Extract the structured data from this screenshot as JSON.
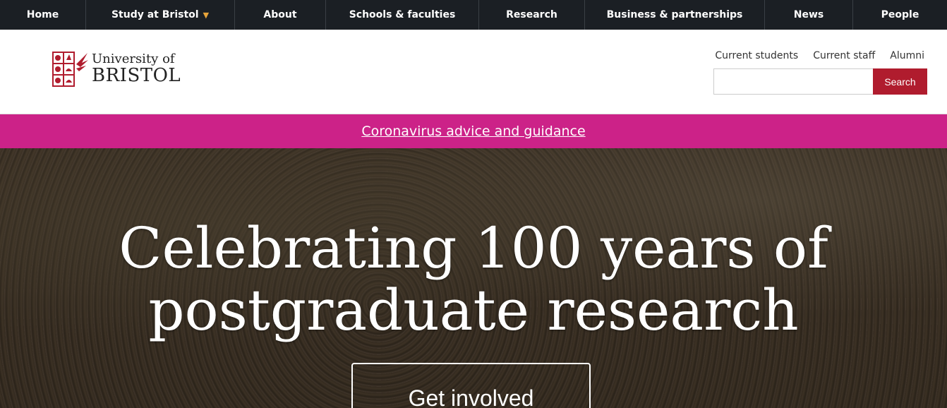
{
  "nav": {
    "items": [
      {
        "label": "Home"
      },
      {
        "label": "Study at Bristol",
        "dropdown": true
      },
      {
        "label": "About"
      },
      {
        "label": "Schools & faculties"
      },
      {
        "label": "Research"
      },
      {
        "label": "Business & partnerships"
      },
      {
        "label": "News"
      },
      {
        "label": "People"
      }
    ]
  },
  "header": {
    "logo_line1": "University of",
    "logo_line2": "BRISTOL",
    "links": [
      "Current students",
      "Current staff",
      "Alumni"
    ],
    "search_value": "",
    "search_button": "Search"
  },
  "banner": {
    "link": "Coronavirus advice and guidance"
  },
  "hero": {
    "title_line1": "Celebrating 100 years of",
    "title_line2": "postgraduate research",
    "cta": "Get involved"
  },
  "colors": {
    "nav_bg": "#1b1f24",
    "brand_red": "#b01c2e",
    "banner": "#cc2288",
    "caret": "#e7a43a"
  },
  "icons": {
    "crest": "university-crest-icon",
    "dropdown": "chevron-down-icon"
  }
}
